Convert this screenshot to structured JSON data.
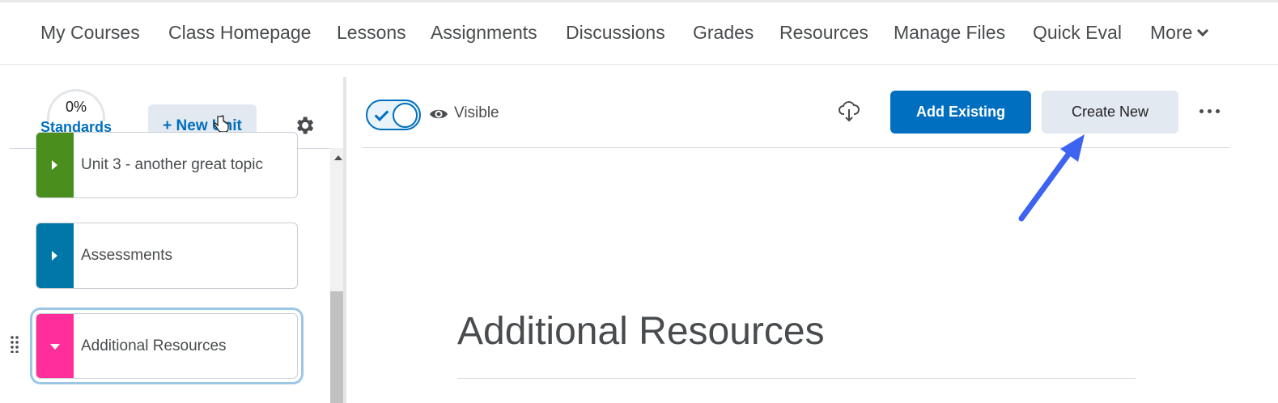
{
  "nav": {
    "items": [
      "My Courses",
      "Class Homepage",
      "Lessons",
      "Assignments",
      "Discussions",
      "Grades",
      "Resources",
      "Manage Files",
      "Quick Eval",
      "More"
    ]
  },
  "sidebar": {
    "progress": "0%",
    "progress_value": 0,
    "standards_label": "Standards",
    "new_unit_label": "+ New Unit",
    "units": [
      {
        "label": "Unit 3 - another great topic",
        "color": "#4a8f1e"
      },
      {
        "label": "Assessments",
        "color": "#0077a8"
      },
      {
        "label": "Additional Resources",
        "color": "#ff2e9a",
        "selected": true
      }
    ]
  },
  "toolbar": {
    "visibility_label": "Visible",
    "visibility_on": true,
    "add_existing_label": "Add Existing",
    "create_new_label": "Create New"
  },
  "main": {
    "title": "Additional Resources"
  },
  "colors": {
    "accent": "#006fbf",
    "annotation_arrow": "#3d63f0"
  }
}
